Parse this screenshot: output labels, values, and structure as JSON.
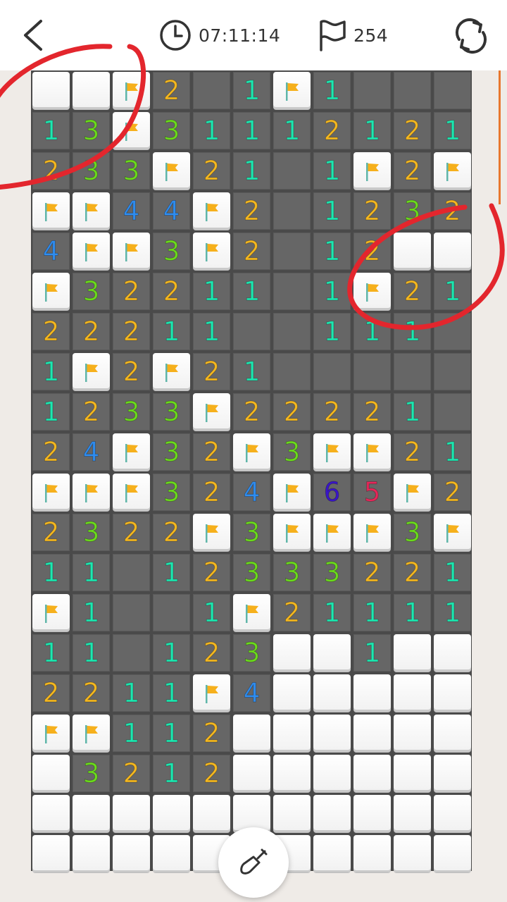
{
  "header": {
    "back_icon": "chevron-left-icon",
    "timer_icon": "clock-icon",
    "timer_value": "07:11:14",
    "flag_icon": "flag-outline-icon",
    "flag_count": "254",
    "restart_icon": "refresh-icon"
  },
  "board": {
    "columns": 11,
    "rows": [
      [
        "C",
        "C",
        "F",
        "2",
        "O",
        "1",
        "F",
        "1",
        "O",
        "O",
        "O"
      ],
      [
        "1",
        "3",
        "F",
        "3",
        "1",
        "1",
        "1",
        "2",
        "1",
        "2",
        "1"
      ],
      [
        "2",
        "3",
        "3",
        "F",
        "2",
        "1",
        "O",
        "1",
        "F",
        "2",
        "F"
      ],
      [
        "F",
        "F",
        "4",
        "4",
        "F",
        "2",
        "O",
        "1",
        "2",
        "3",
        "2"
      ],
      [
        "4",
        "F",
        "F",
        "3",
        "F",
        "2",
        "O",
        "1",
        "2",
        "C",
        "C"
      ],
      [
        "F",
        "3",
        "2",
        "2",
        "1",
        "1",
        "O",
        "1",
        "F",
        "2",
        "1"
      ],
      [
        "2",
        "2",
        "2",
        "1",
        "1",
        "O",
        "O",
        "1",
        "1",
        "1",
        "O"
      ],
      [
        "1",
        "F",
        "2",
        "F",
        "2",
        "1",
        "O",
        "O",
        "O",
        "O",
        "O"
      ],
      [
        "1",
        "2",
        "3",
        "3",
        "F",
        "2",
        "2",
        "2",
        "2",
        "1",
        "O"
      ],
      [
        "2",
        "4",
        "F",
        "3",
        "2",
        "F",
        "3",
        "F",
        "F",
        "2",
        "1"
      ],
      [
        "F",
        "F",
        "F",
        "3",
        "2",
        "4",
        "F",
        "6",
        "5",
        "F",
        "2"
      ],
      [
        "2",
        "3",
        "2",
        "2",
        "F",
        "3",
        "F",
        "F",
        "F",
        "3",
        "F"
      ],
      [
        "1",
        "1",
        "O",
        "1",
        "2",
        "3",
        "3",
        "3",
        "2",
        "2",
        "1"
      ],
      [
        "F",
        "1",
        "O",
        "O",
        "1",
        "F",
        "2",
        "1",
        "1",
        "1",
        "1"
      ],
      [
        "1",
        "1",
        "O",
        "1",
        "2",
        "3",
        "C",
        "C",
        "1",
        "C",
        "C"
      ],
      [
        "2",
        "2",
        "1",
        "1",
        "F",
        "4",
        "C",
        "C",
        "C",
        "C",
        "C"
      ],
      [
        "F",
        "F",
        "1",
        "1",
        "2",
        "C",
        "C",
        "C",
        "C",
        "C",
        "C"
      ],
      [
        "C",
        "3",
        "2",
        "1",
        "2",
        "C",
        "C",
        "C",
        "C",
        "C",
        "C"
      ],
      [
        "C",
        "C",
        "C",
        "C",
        "C",
        "C",
        "C",
        "C",
        "C",
        "C",
        "C"
      ],
      [
        "C",
        "C",
        "C",
        "C",
        "C",
        "C",
        "C",
        "C",
        "C",
        "C",
        "C"
      ]
    ],
    "legend": {
      "C": "unrevealed",
      "O": "revealed-empty",
      "F": "flagged"
    }
  },
  "colors": {
    "n1": "#1de7b0",
    "n2": "#f5b820",
    "n3": "#6cdc1c",
    "n4": "#2f8df0",
    "n5": "#e8275a",
    "n6": "#3a16c8",
    "flag": "#f6b01c",
    "annotation": "#e3262d"
  },
  "tool": {
    "icon": "shovel-icon",
    "mode": "dig"
  }
}
